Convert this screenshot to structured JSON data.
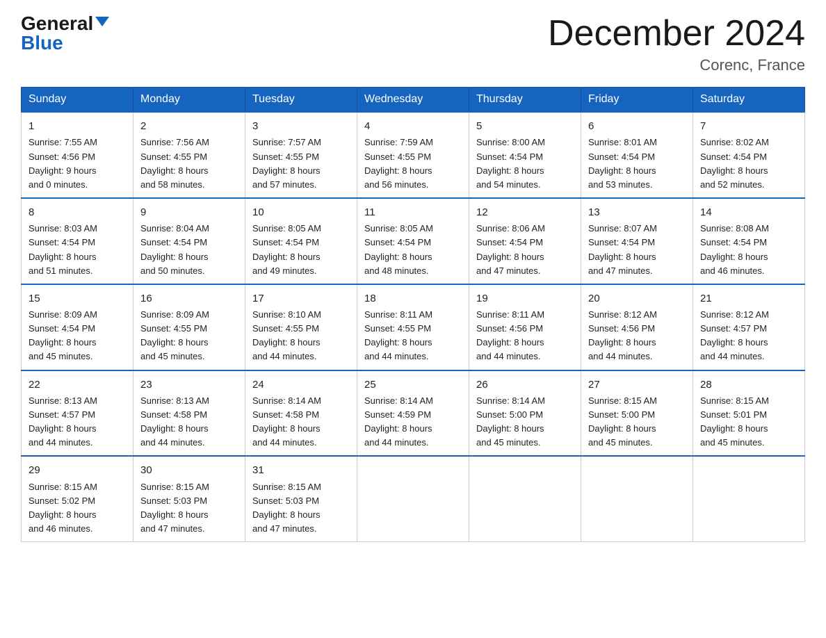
{
  "logo": {
    "general": "General",
    "blue": "Blue"
  },
  "title": "December 2024",
  "location": "Corenc, France",
  "weekdays": [
    "Sunday",
    "Monday",
    "Tuesday",
    "Wednesday",
    "Thursday",
    "Friday",
    "Saturday"
  ],
  "weeks": [
    [
      {
        "day": "1",
        "sunrise": "7:55 AM",
        "sunset": "4:56 PM",
        "daylight": "9 hours and 0 minutes."
      },
      {
        "day": "2",
        "sunrise": "7:56 AM",
        "sunset": "4:55 PM",
        "daylight": "8 hours and 58 minutes."
      },
      {
        "day": "3",
        "sunrise": "7:57 AM",
        "sunset": "4:55 PM",
        "daylight": "8 hours and 57 minutes."
      },
      {
        "day": "4",
        "sunrise": "7:59 AM",
        "sunset": "4:55 PM",
        "daylight": "8 hours and 56 minutes."
      },
      {
        "day": "5",
        "sunrise": "8:00 AM",
        "sunset": "4:54 PM",
        "daylight": "8 hours and 54 minutes."
      },
      {
        "day": "6",
        "sunrise": "8:01 AM",
        "sunset": "4:54 PM",
        "daylight": "8 hours and 53 minutes."
      },
      {
        "day": "7",
        "sunrise": "8:02 AM",
        "sunset": "4:54 PM",
        "daylight": "8 hours and 52 minutes."
      }
    ],
    [
      {
        "day": "8",
        "sunrise": "8:03 AM",
        "sunset": "4:54 PM",
        "daylight": "8 hours and 51 minutes."
      },
      {
        "day": "9",
        "sunrise": "8:04 AM",
        "sunset": "4:54 PM",
        "daylight": "8 hours and 50 minutes."
      },
      {
        "day": "10",
        "sunrise": "8:05 AM",
        "sunset": "4:54 PM",
        "daylight": "8 hours and 49 minutes."
      },
      {
        "day": "11",
        "sunrise": "8:05 AM",
        "sunset": "4:54 PM",
        "daylight": "8 hours and 48 minutes."
      },
      {
        "day": "12",
        "sunrise": "8:06 AM",
        "sunset": "4:54 PM",
        "daylight": "8 hours and 47 minutes."
      },
      {
        "day": "13",
        "sunrise": "8:07 AM",
        "sunset": "4:54 PM",
        "daylight": "8 hours and 47 minutes."
      },
      {
        "day": "14",
        "sunrise": "8:08 AM",
        "sunset": "4:54 PM",
        "daylight": "8 hours and 46 minutes."
      }
    ],
    [
      {
        "day": "15",
        "sunrise": "8:09 AM",
        "sunset": "4:54 PM",
        "daylight": "8 hours and 45 minutes."
      },
      {
        "day": "16",
        "sunrise": "8:09 AM",
        "sunset": "4:55 PM",
        "daylight": "8 hours and 45 minutes."
      },
      {
        "day": "17",
        "sunrise": "8:10 AM",
        "sunset": "4:55 PM",
        "daylight": "8 hours and 44 minutes."
      },
      {
        "day": "18",
        "sunrise": "8:11 AM",
        "sunset": "4:55 PM",
        "daylight": "8 hours and 44 minutes."
      },
      {
        "day": "19",
        "sunrise": "8:11 AM",
        "sunset": "4:56 PM",
        "daylight": "8 hours and 44 minutes."
      },
      {
        "day": "20",
        "sunrise": "8:12 AM",
        "sunset": "4:56 PM",
        "daylight": "8 hours and 44 minutes."
      },
      {
        "day": "21",
        "sunrise": "8:12 AM",
        "sunset": "4:57 PM",
        "daylight": "8 hours and 44 minutes."
      }
    ],
    [
      {
        "day": "22",
        "sunrise": "8:13 AM",
        "sunset": "4:57 PM",
        "daylight": "8 hours and 44 minutes."
      },
      {
        "day": "23",
        "sunrise": "8:13 AM",
        "sunset": "4:58 PM",
        "daylight": "8 hours and 44 minutes."
      },
      {
        "day": "24",
        "sunrise": "8:14 AM",
        "sunset": "4:58 PM",
        "daylight": "8 hours and 44 minutes."
      },
      {
        "day": "25",
        "sunrise": "8:14 AM",
        "sunset": "4:59 PM",
        "daylight": "8 hours and 44 minutes."
      },
      {
        "day": "26",
        "sunrise": "8:14 AM",
        "sunset": "5:00 PM",
        "daylight": "8 hours and 45 minutes."
      },
      {
        "day": "27",
        "sunrise": "8:15 AM",
        "sunset": "5:00 PM",
        "daylight": "8 hours and 45 minutes."
      },
      {
        "day": "28",
        "sunrise": "8:15 AM",
        "sunset": "5:01 PM",
        "daylight": "8 hours and 45 minutes."
      }
    ],
    [
      {
        "day": "29",
        "sunrise": "8:15 AM",
        "sunset": "5:02 PM",
        "daylight": "8 hours and 46 minutes."
      },
      {
        "day": "30",
        "sunrise": "8:15 AM",
        "sunset": "5:03 PM",
        "daylight": "8 hours and 47 minutes."
      },
      {
        "day": "31",
        "sunrise": "8:15 AM",
        "sunset": "5:03 PM",
        "daylight": "8 hours and 47 minutes."
      },
      null,
      null,
      null,
      null
    ]
  ]
}
